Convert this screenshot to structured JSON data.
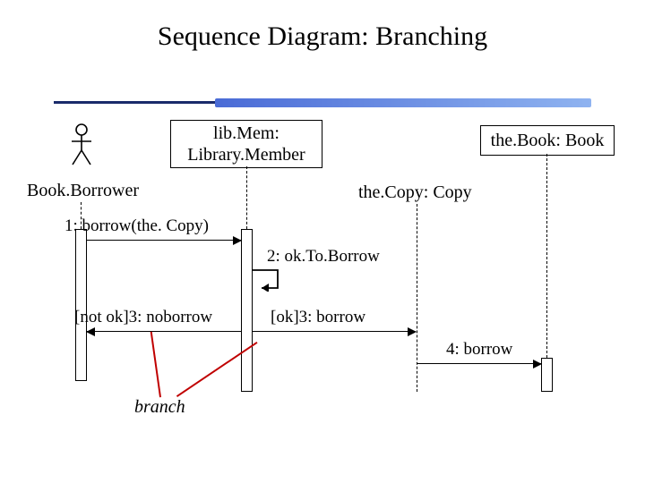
{
  "title": "Sequence Diagram: Branching",
  "participants": {
    "actor": "Book.Borrower",
    "libMem": "lib.Mem: Library.Member",
    "theCopy": "the.Copy: Copy",
    "theBook": "the.Book: Book"
  },
  "messages": {
    "m1": "1: borrow(the. Copy)",
    "m2": "2: ok.To.Borrow",
    "m3a": "[not ok]3: noborrow",
    "m3b": "[ok]3: borrow",
    "m4": "4: borrow"
  },
  "annotation": "branch"
}
